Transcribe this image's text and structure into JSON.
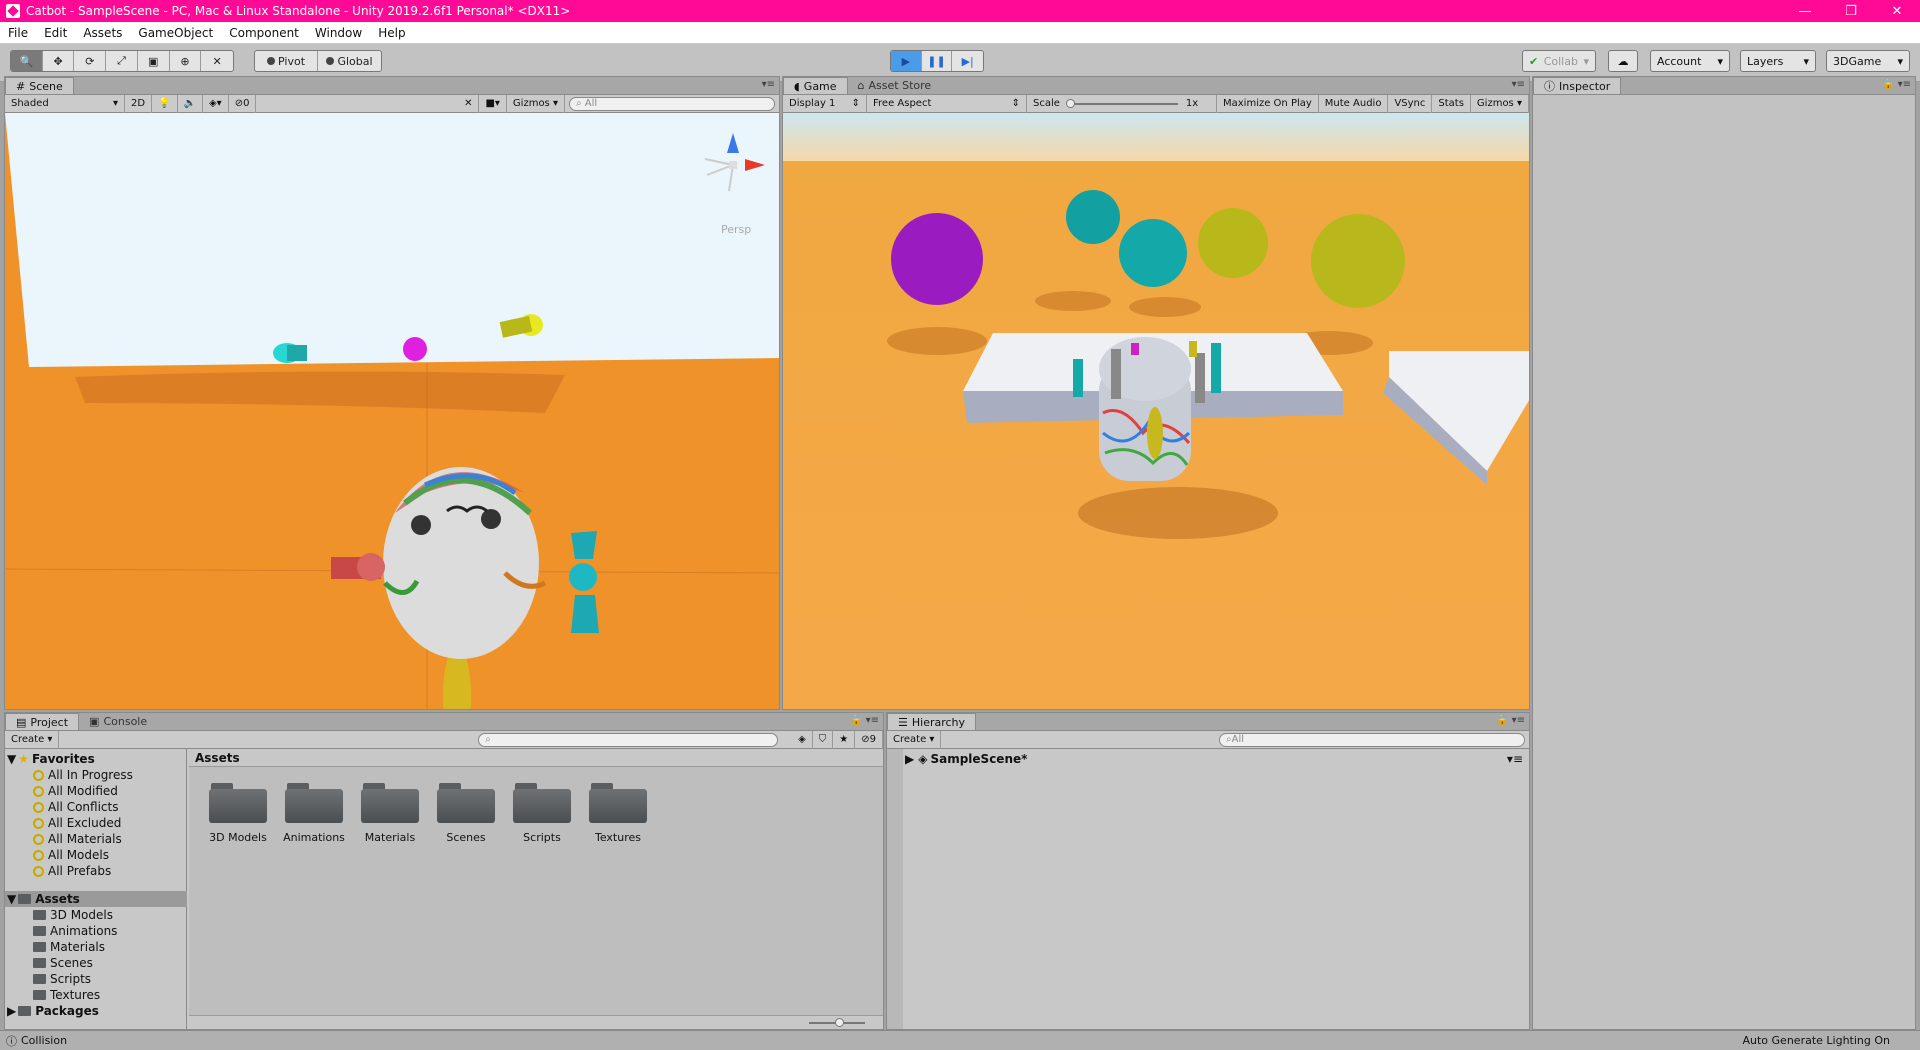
{
  "window": {
    "title": "Catbot - SampleScene - PC, Mac & Linux Standalone - Unity 2019.2.6f1 Personal* <DX11>",
    "minimize": "—",
    "restore": "❐",
    "close": "✕"
  },
  "menu": [
    "File",
    "Edit",
    "Assets",
    "GameObject",
    "Component",
    "Window",
    "Help"
  ],
  "toolbar": {
    "tools": [
      "hand-tool",
      "move-tool",
      "rotate-tool",
      "scale-tool",
      "rect-tool",
      "transform-tool",
      "custom-tool"
    ],
    "tool_glyphs": [
      "🔍",
      "✥",
      "⟳",
      "⤢",
      "▣",
      "⊕",
      "✕"
    ],
    "pivot": "Pivot",
    "global": "Global",
    "play_glyph": "▶",
    "pause_glyph": "❚❚",
    "step_glyph": "▶|",
    "collab": "Collab",
    "cloud_glyph": "☁",
    "account": "Account",
    "layers": "Layers",
    "layout": "3DGame"
  },
  "scene_panel": {
    "tab": "Scene",
    "shading": "Shaded",
    "mode_2d": "2D",
    "hidden_count": "0",
    "gizmos": "Gizmos",
    "search_placeholder": "All",
    "persp": "Persp"
  },
  "game_panel": {
    "tab_game": "Game",
    "tab_store": "Asset Store",
    "display": "Display 1",
    "aspect": "Free Aspect",
    "scale_label": "Scale",
    "scale_value": "1x",
    "maximize": "Maximize On Play",
    "mute": "Mute Audio",
    "vsync": "VSync",
    "stats": "Stats",
    "gizmos": "Gizmos"
  },
  "inspector": {
    "tab": "Inspector"
  },
  "project_panel": {
    "tab_project": "Project",
    "tab_console": "Console",
    "create": "Create",
    "hidden_count": "9",
    "assets_header": "Assets",
    "favorites_label": "Favorites",
    "favorites": [
      "All In Progress",
      "All Modified",
      "All Conflicts",
      "All Excluded",
      "All Materials",
      "All Models",
      "All Prefabs"
    ],
    "assets_label": "Assets",
    "asset_folders": [
      "3D Models",
      "Animations",
      "Materials",
      "Scenes",
      "Scripts",
      "Textures"
    ],
    "packages_label": "Packages",
    "grid_folders": [
      "3D Models",
      "Animations",
      "Materials",
      "Scenes",
      "Scripts",
      "Textures"
    ]
  },
  "hierarchy_panel": {
    "tab": "Hierarchy",
    "create": "Create",
    "search_placeholder": "All",
    "scene": "SampleScene*"
  },
  "status": {
    "left": "Collision",
    "right": "Auto Generate Lighting On"
  },
  "colors": {
    "titlebar": "#ff0a96",
    "play_active": "#4a9be8",
    "ground": "#f0922a",
    "sky": "#eaf6fb"
  }
}
